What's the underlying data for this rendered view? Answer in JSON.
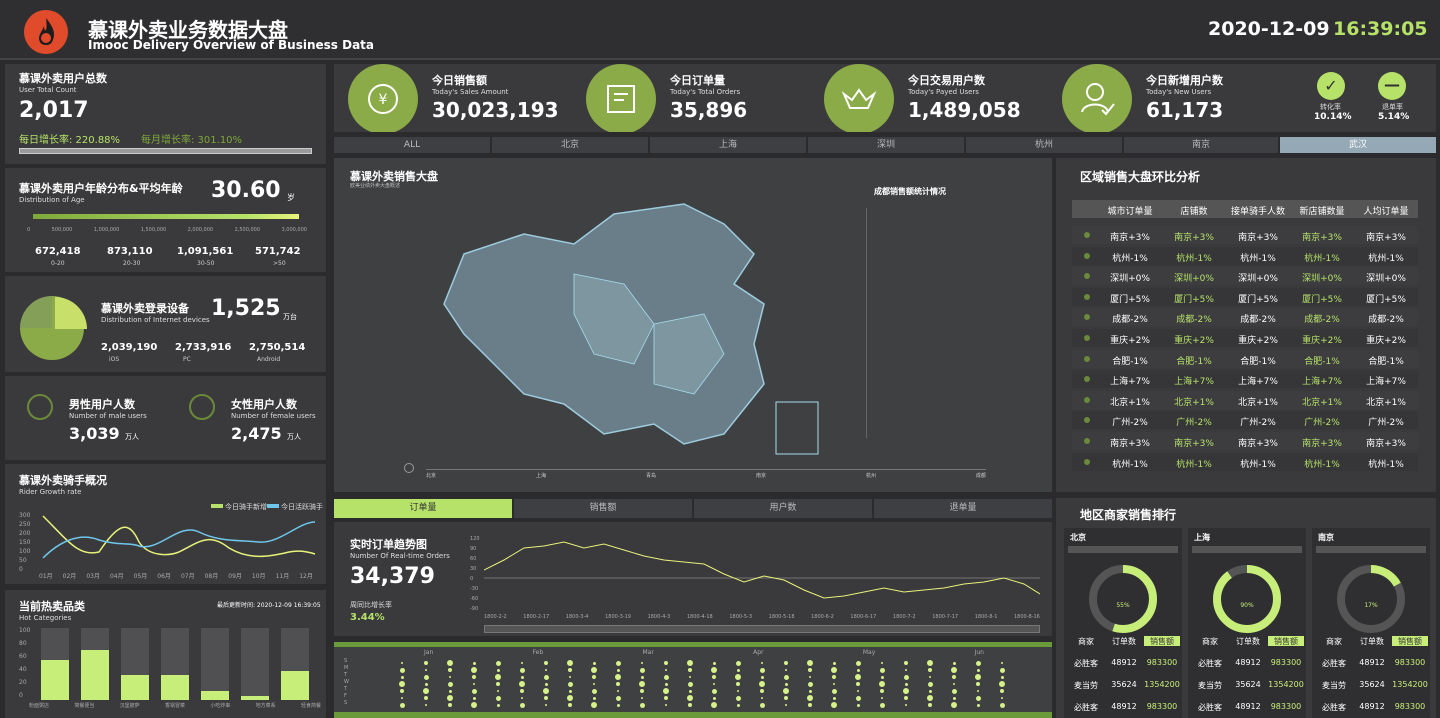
{
  "header": {
    "title": "慕课外卖业务数据大盘",
    "subtitle": "Imooc Delivery Overview of Business Data",
    "date": "2020-12-09",
    "time": "16:39:05"
  },
  "users": {
    "title": "慕课外卖用户总数",
    "sub": "User Total Count",
    "value": "2,017",
    "daily": "每日增长率: 220.88%",
    "monthly": "每月增长率: 301.10%"
  },
  "age": {
    "title": "慕课外卖用户年龄分布&平均年龄",
    "sub": "Distribution of Age",
    "avg": "30.60",
    "unit": "岁",
    "ticks": [
      "0",
      "500,000",
      "1,000,000",
      "1,500,000",
      "2,000,000",
      "2,500,000",
      "3,000,000"
    ],
    "groups": [
      {
        "v": "672,418",
        "l": "0-20"
      },
      {
        "v": "873,110",
        "l": "20-30"
      },
      {
        "v": "1,091,561",
        "l": "30-50"
      },
      {
        "v": "571,742",
        "l": ">50"
      }
    ]
  },
  "devices": {
    "title": "慕课外卖登录设备",
    "sub": "Distribution of Internet devices",
    "value": "1,525",
    "unit": "万台",
    "items": [
      {
        "v": "2,039,190",
        "l": "iOS"
      },
      {
        "v": "2,733,916",
        "l": "PC"
      },
      {
        "v": "2,750,514",
        "l": "Android"
      }
    ]
  },
  "gender": {
    "male_title": "男性用户人数",
    "male_sub": "Number of male users",
    "male": "3,039",
    "female_title": "女性用户人数",
    "female_sub": "Number of female users",
    "female": "2,475",
    "unit": "万人"
  },
  "rider": {
    "title": "慕课外卖骑手概况",
    "sub": "Rider Growth rate",
    "legend1": "今日骑手新增",
    "legend2": "今日活跃骑手",
    "months": [
      "01月",
      "02月",
      "03月",
      "04月",
      "05月",
      "06月",
      "07月",
      "08月",
      "09月",
      "10月",
      "11月",
      "12月"
    ],
    "yticks": [
      "300",
      "250",
      "200",
      "150",
      "100",
      "50",
      "0"
    ]
  },
  "hot": {
    "title": "当前热卖品类",
    "sub": "Hot Categories",
    "updated": "最后更新时间: 2020-12-09 16:39:05",
    "cats": [
      "粉面粥店",
      "简餐便当",
      "汉堡披萨",
      "香锅冒菜",
      "小吃炸串",
      "地方菜系",
      "轻食简餐"
    ],
    "values": [
      55,
      70,
      35,
      35,
      12,
      5,
      40
    ],
    "yticks": [
      "100",
      "80",
      "60",
      "40",
      "20",
      "0"
    ]
  },
  "kpi": [
    {
      "label": "今日销售额",
      "sub": "Today's Sales Amount",
      "value": "30,023,193",
      "icon": "yen-icon"
    },
    {
      "label": "今日订单量",
      "sub": "Today's Total Orders",
      "value": "35,896",
      "icon": "order-icon"
    },
    {
      "label": "今日交易用户数",
      "sub": "Today's Payed Users",
      "value": "1,489,058",
      "icon": "basket-icon"
    },
    {
      "label": "今日新增用户数",
      "sub": "Today's New Users",
      "value": "61,173",
      "icon": "user-icon"
    }
  ],
  "rates": [
    {
      "l": "转化率",
      "v": "10.14%"
    },
    {
      "l": "退单率",
      "v": "5.14%"
    }
  ],
  "cities": [
    "ALL",
    "北京",
    "上海",
    "深圳",
    "杭州",
    "南京",
    "武汉"
  ],
  "map": {
    "title": "慕课外卖销售大盘",
    "sub": "欧美业绩外卖大盘概述",
    "chart_title": "成都销售额统计情况",
    "timeline": [
      "北京",
      "上海",
      "青岛",
      "南京",
      "杭州",
      "成都"
    ]
  },
  "region": {
    "title": "区域销售大盘环比分析",
    "headers": [
      "城市订单量",
      "店铺数",
      "接单骑手人数",
      "新店铺数量",
      "人均订单量"
    ],
    "rows": [
      [
        "南京+3%"
      ],
      [
        "杭州-1%"
      ],
      [
        "深圳+0%"
      ],
      [
        "厦门+5%"
      ],
      [
        "成都-2%"
      ],
      [
        "重庆+2%"
      ],
      [
        "合肥-1%"
      ],
      [
        "上海+7%"
      ],
      [
        "北京+1%"
      ],
      [
        "广州-2%"
      ],
      [
        "南京+3%"
      ],
      [
        "杭州-1%"
      ]
    ]
  },
  "tabs2": [
    "订单量",
    "销售额",
    "用户数",
    "退单量"
  ],
  "trend": {
    "title": "实时订单趋势图",
    "sub": "Number Of Real-time Orders",
    "value": "34,379",
    "week": "周同比增长率",
    "week_v": "3.44%",
    "yticks": [
      "120",
      "90",
      "60",
      "30",
      "0",
      "-30",
      "-60",
      "-90"
    ],
    "xticks": [
      "1800-2-2",
      "1800-2-17",
      "1800-3-4",
      "1800-3-19",
      "1800-4-3",
      "1800-4-18",
      "1800-5-3",
      "1800-5-18",
      "1800-6-2",
      "1800-6-17",
      "1800-7-2",
      "1800-7-17",
      "1800-8-1",
      "1800-8-16"
    ]
  },
  "calendar": {
    "months": [
      "Jan",
      "Feb",
      "Mar",
      "Apr",
      "May",
      "Jun"
    ],
    "days": [
      "S",
      "M",
      "T",
      "W",
      "T",
      "F",
      "S"
    ]
  },
  "rank": {
    "title": "地区商家销售排行",
    "cols": [
      {
        "city": "北京",
        "pct": "55%",
        "rows": [
          [
            "必胜客",
            "48912",
            "983300"
          ],
          [
            "麦当劳",
            "35624",
            "1354200"
          ],
          [
            "必胜客",
            "48912",
            "983300"
          ]
        ]
      },
      {
        "city": "上海",
        "pct": "90%",
        "rows": [
          [
            "必胜客",
            "48912",
            "983300"
          ],
          [
            "麦当劳",
            "35624",
            "1354200"
          ],
          [
            "必胜客",
            "48912",
            "983300"
          ]
        ]
      },
      {
        "city": "南京",
        "pct": "17%",
        "rows": [
          [
            "必胜客",
            "48912",
            "983300"
          ],
          [
            "麦当劳",
            "35624",
            "1354200"
          ],
          [
            "必胜客",
            "48912",
            "983300"
          ]
        ]
      }
    ],
    "heads": [
      "商家",
      "订单数",
      "销售额"
    ]
  }
}
